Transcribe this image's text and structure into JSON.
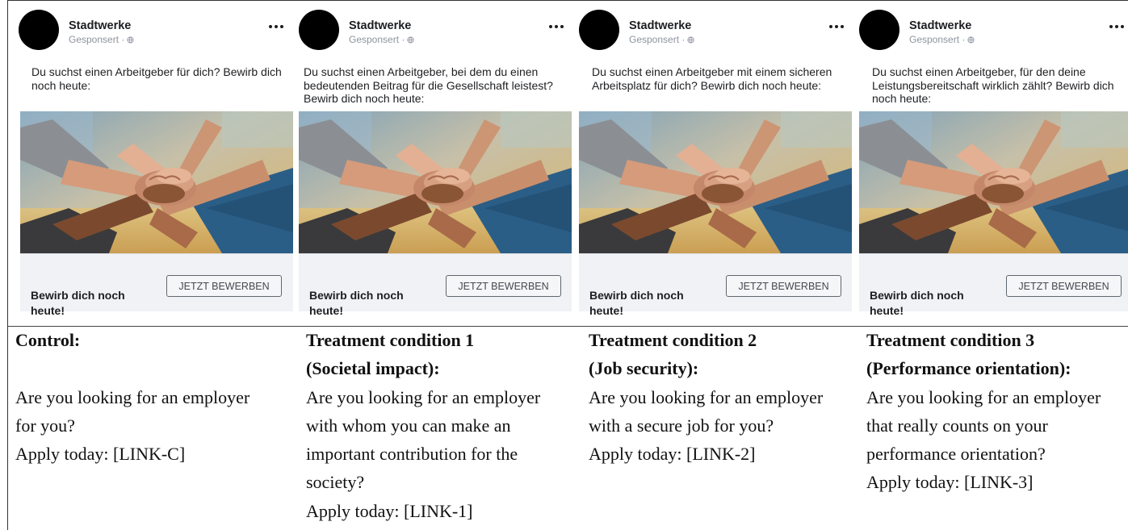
{
  "ads": [
    {
      "page_name": "Stadtwerke",
      "sponsored": "Gesponsert ·",
      "text": "Du suchst einen Arbeitgeber für dich? Bewirb dich noch heute:",
      "cta_headline": "Bewirb dich noch heute!",
      "cta_button": "JETZT BEWERBEN"
    },
    {
      "page_name": "Stadtwerke",
      "sponsored": "Gesponsert ·",
      "text": "Du suchst einen Arbeitgeber, bei dem du einen bedeutenden Beitrag für die Gesellschaft leistest? Bewirb dich noch heute:",
      "cta_headline": "Bewirb dich noch heute!",
      "cta_button": "JETZT BEWERBEN"
    },
    {
      "page_name": "Stadtwerke",
      "sponsored": "Gesponsert ·",
      "text": "Du suchst einen Arbeitgeber mit einem sicheren Arbeitsplatz für dich? Bewirb dich noch heute:",
      "cta_headline": "Bewirb dich noch heute!",
      "cta_button": "JETZT BEWERBEN"
    },
    {
      "page_name": "Stadtwerke",
      "sponsored": "Gesponsert ·",
      "text": "Du suchst einen Arbeitgeber, für den deine Leistungsbereitschaft wirklich zählt? Bewirb dich noch heute:",
      "cta_headline": "Bewirb dich noch heute!",
      "cta_button": "JETZT BEWERBEN"
    }
  ],
  "captions": [
    {
      "title": "Control:",
      "lines": [
        "",
        "Are you looking for an employer",
        "for you?",
        "Apply today: [LINK-C]"
      ]
    },
    {
      "title": "Treatment condition 1",
      "subtitle": "(Societal impact):",
      "lines": [
        "Are you looking for an employer",
        "with whom you can make an",
        "important contribution for the",
        "society?",
        "Apply today: [LINK-1]"
      ]
    },
    {
      "title": "Treatment condition 2",
      "subtitle": "(Job security):",
      "lines": [
        "Are you looking for an employer",
        "with a secure job for you?",
        "Apply today: [LINK-2]"
      ]
    },
    {
      "title": "Treatment condition 3",
      "subtitle": "(Performance orientation):",
      "lines": [
        "Are you looking for an employer",
        "that really counts on your",
        "performance orientation?",
        "Apply today: [LINK-3]"
      ]
    }
  ],
  "icons": {
    "avatar": "page-avatar",
    "audience": "globe-icon",
    "menu": "more-options-icon"
  },
  "colors": {
    "cta_bar": "#f0f2f5",
    "avatar": "#000000",
    "sponsored_text": "#8d949e"
  }
}
